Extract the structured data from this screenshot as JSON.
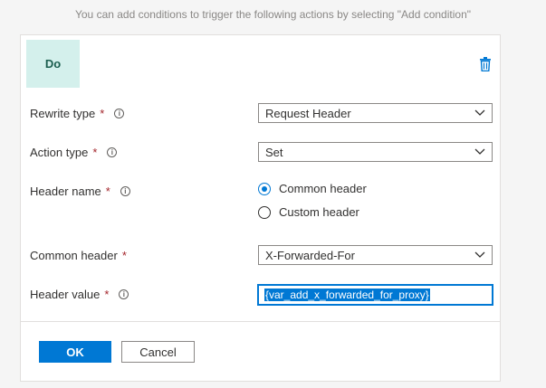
{
  "hint_text": "You can add conditions to trigger the following actions by selecting \"Add condition\"",
  "do_label": "Do",
  "delete_icon": "trash-icon",
  "fields": {
    "rewrite_type": {
      "label": "Rewrite type",
      "required": "*",
      "value": "Request Header"
    },
    "action_type": {
      "label": "Action type",
      "required": "*",
      "value": "Set"
    },
    "header_name": {
      "label": "Header name",
      "required": "*",
      "options": [
        {
          "label": "Common header",
          "selected": true
        },
        {
          "label": "Custom header",
          "selected": false
        }
      ]
    },
    "common_header": {
      "label": "Common header",
      "required": "*",
      "value": "X-Forwarded-For"
    },
    "header_value": {
      "label": "Header value",
      "required": "*",
      "value": "{var_add_x_forwarded_for_proxy}"
    }
  },
  "info_icon_glyph": "i",
  "buttons": {
    "ok": "OK",
    "cancel": "Cancel"
  },
  "colors": {
    "accent": "#0078d4",
    "do_bg": "#d4f0ec",
    "required": "#a4262c"
  }
}
